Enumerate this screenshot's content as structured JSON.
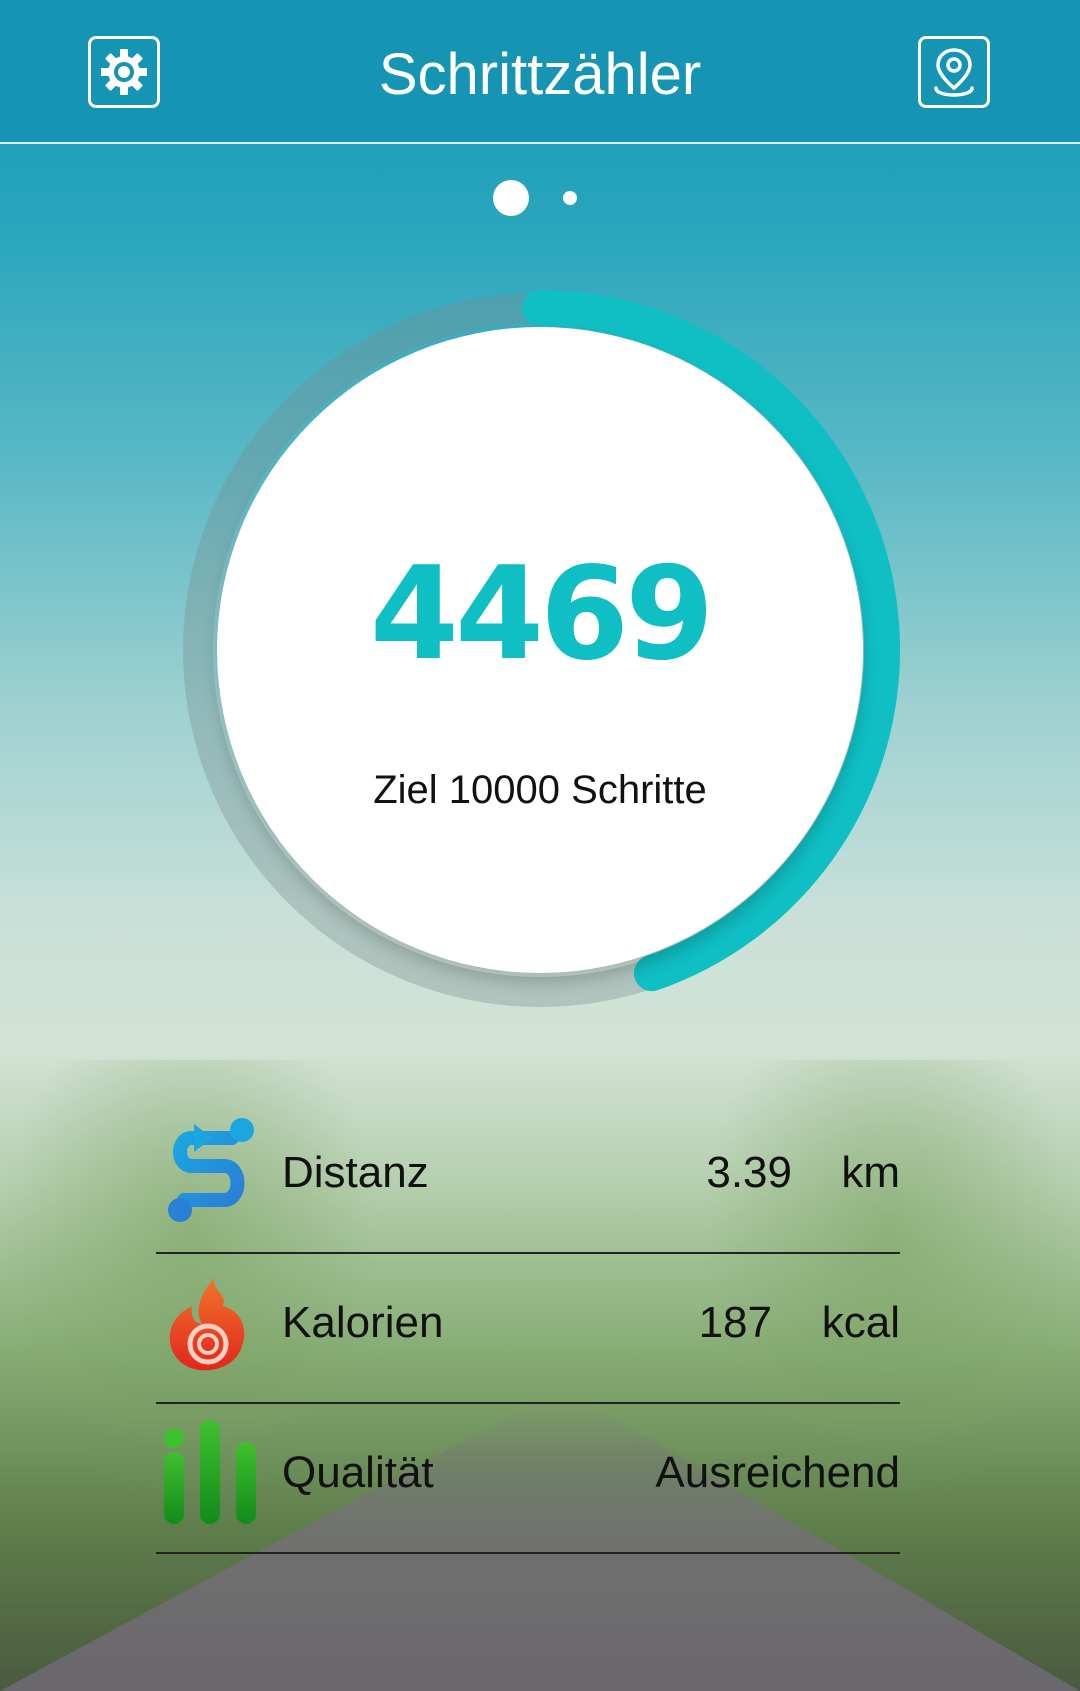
{
  "header": {
    "title": "Schrittzähler",
    "settings_icon": "gear-icon",
    "location_icon": "location-pin-icon"
  },
  "pager": {
    "pages": 2,
    "active_index": 0
  },
  "progress": {
    "steps": "4469",
    "goal_text": "Ziel 10000 Schritte",
    "fraction": 0.4469,
    "color": "#0fbfc4"
  },
  "stats": [
    {
      "label": "Distanz",
      "value": "3.39",
      "unit": "km",
      "icon": "route-icon"
    },
    {
      "label": "Kalorien",
      "value": "187",
      "unit": "kcal",
      "icon": "flame-icon"
    },
    {
      "label": "Qualität",
      "value": "Ausreichend",
      "unit": "",
      "icon": "bar-chart-icon"
    }
  ]
}
